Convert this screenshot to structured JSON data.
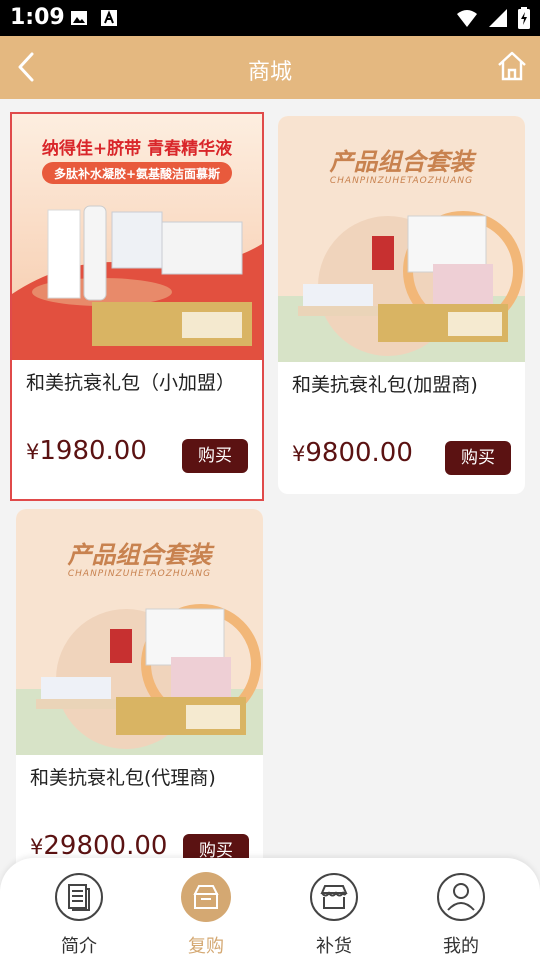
{
  "status_bar": {
    "time": "1:09"
  },
  "header": {
    "title": "商城"
  },
  "products": [
    {
      "name": "和美抗衰礼包（小加盟）",
      "price_symbol": "¥",
      "price": "1980.00",
      "buy_label": "购买",
      "banner_title": "纳得佳+脐带 青春精华液",
      "banner_subtitle": "多肽补水凝胶+氨基酸洁面慕斯"
    },
    {
      "name": "和美抗衰礼包(加盟商)",
      "price_symbol": "¥",
      "price": "9800.00",
      "buy_label": "购买",
      "banner_title": "产品组合套装",
      "banner_subtitle": "CHANPINZUHETAOZHUANG"
    },
    {
      "name": "和美抗衰礼包(代理商)",
      "price_symbol": "¥",
      "price": "29800.00",
      "buy_label": "购买",
      "banner_title": "产品组合套装",
      "banner_subtitle": "CHANPINZUHETAOZHUANG"
    }
  ],
  "bottom_nav": [
    {
      "label": "简介",
      "icon": "document-icon",
      "active": false
    },
    {
      "label": "复购",
      "icon": "box-icon",
      "active": true
    },
    {
      "label": "补货",
      "icon": "store-icon",
      "active": false
    },
    {
      "label": "我的",
      "icon": "user-icon",
      "active": false
    }
  ],
  "colors": {
    "header": "#e4b880",
    "price": "#5b1212",
    "buy_button": "#5b1212",
    "nav_active": "#d4a872",
    "selected_border": "#e04a4a"
  }
}
